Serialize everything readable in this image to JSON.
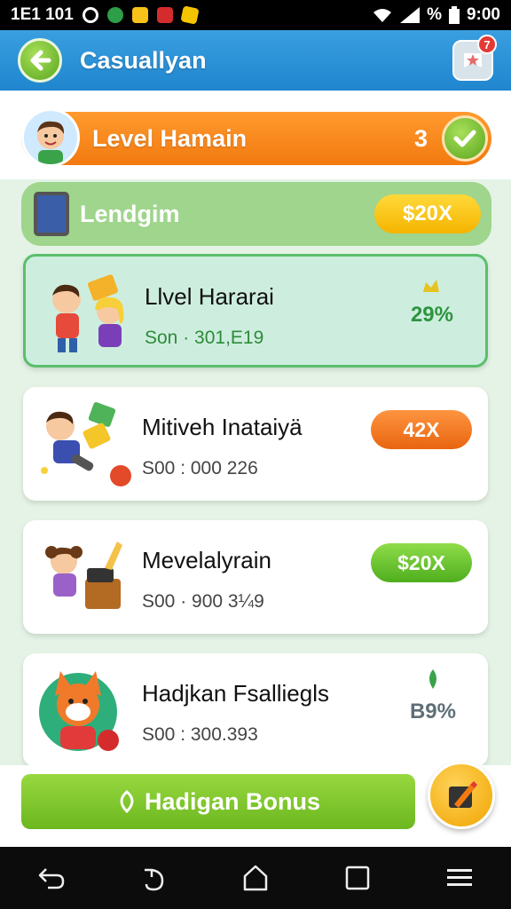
{
  "status_bar": {
    "left_text": "1E1 101",
    "battery_text": "%",
    "time": "9:00"
  },
  "app_bar": {
    "title": "Casuallyan",
    "notification_count": "7"
  },
  "level": {
    "title": "Level Hamain",
    "count": "3"
  },
  "section": {
    "title": "Lendgim",
    "pill": "$20X"
  },
  "cards": [
    {
      "title": "Llvel Hararai",
      "subtitle": "Son · 301,E19",
      "percent": "29%"
    },
    {
      "title": "Mitiveh Inataiyä",
      "subtitle": "S00 : 000 226",
      "pill": "42X"
    },
    {
      "title": "Mevelalyrain",
      "subtitle": "S00 · 900 3¼9",
      "pill": "$20X"
    },
    {
      "title": "Hadjkan Fsalliegls",
      "subtitle": "S00 : 300.393",
      "percent": "B9%"
    }
  ],
  "bonus_button": {
    "label": "Hadigan Bonus"
  },
  "colors": {
    "accent_blue": "#2b93d8",
    "orange": "#f27a10",
    "green": "#6cb71f",
    "yellow": "#f5b400"
  },
  "icons": [
    "back-arrow",
    "star-badge",
    "check",
    "tablet",
    "leaf",
    "pencil",
    "back",
    "recent",
    "home",
    "square",
    "menu"
  ]
}
